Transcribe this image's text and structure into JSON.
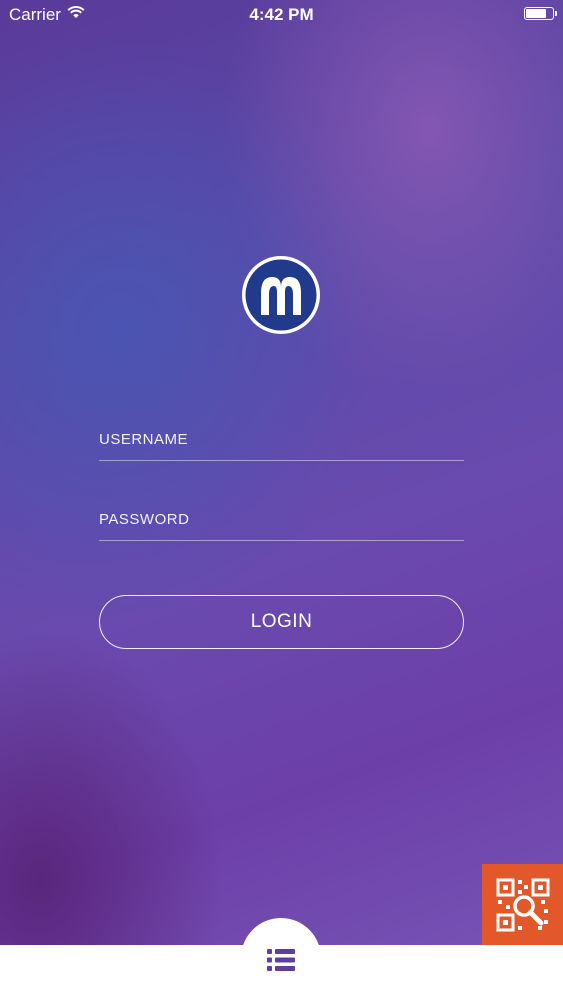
{
  "status_bar": {
    "carrier": "Carrier",
    "time": "4:42 PM",
    "wifi_icon": "wifi-icon",
    "battery_icon": "battery-icon"
  },
  "logo": {
    "icon": "brand-m-logo",
    "colors": {
      "ring": "#ffffff",
      "fill": "#223a8c"
    }
  },
  "login_form": {
    "username_placeholder": "USERNAME",
    "username_value": "",
    "password_placeholder": "PASSWORD",
    "password_value": "",
    "login_label": "LOGIN"
  },
  "qr_scan": {
    "icon": "qr-scan-icon",
    "color": "#e2582a"
  },
  "bottom_nav": {
    "menu_icon": "list-menu-icon",
    "icon_color": "#5e3fa0"
  }
}
